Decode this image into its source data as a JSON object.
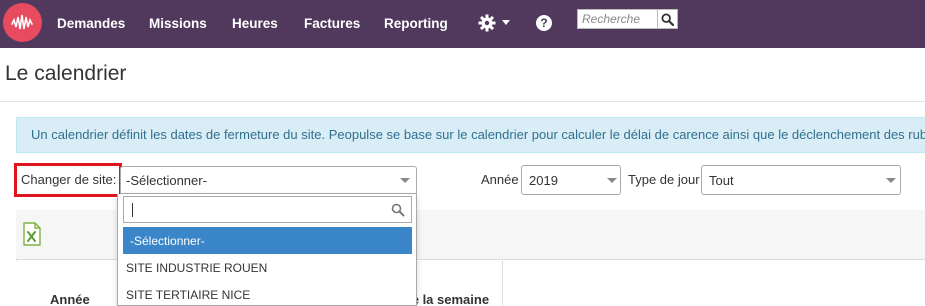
{
  "nav": {
    "items": [
      "Demandes",
      "Missions",
      "Heures",
      "Factures",
      "Reporting"
    ],
    "gear_icon": "gear-icon",
    "help_icon": "question-circle-icon",
    "help_glyph": "?",
    "search_placeholder": "Recherche"
  },
  "page": {
    "title": "Le calendrier",
    "info": "Un calendrier définit les dates de fermeture du site. Peopulse se base sur le calendrier pour calculer le délai de carence ainsi que le déclenchement des rubriques"
  },
  "filters": {
    "site_label": "Changer de site:",
    "site_value": "-Sélectionner-",
    "year_label": "Année",
    "year_value": "2019",
    "daytype_label": "Type de jour",
    "daytype_value": "Tout"
  },
  "dropdown": {
    "options": [
      "-Sélectionner-",
      "SITE INDUSTRIE ROUEN",
      "SITE TERTIAIRE NICE"
    ],
    "selected_index": 0
  },
  "table": {
    "columns": [
      "Année",
      "Jour de la semaine"
    ]
  },
  "colors": {
    "navbar": "#51395e",
    "logo": "#e84a5f",
    "info_bg": "#d9edf7",
    "info_text": "#31708f",
    "highlight": "#e0141f",
    "option_active": "#3a86c8"
  }
}
